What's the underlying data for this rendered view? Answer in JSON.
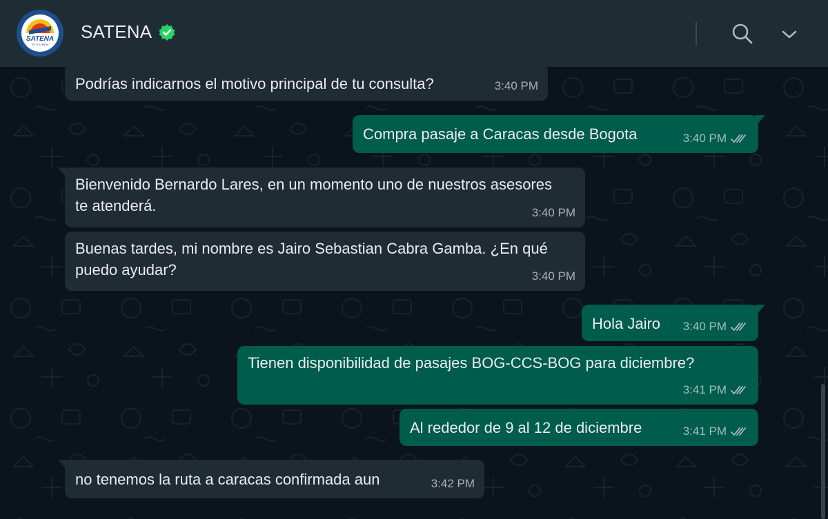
{
  "header": {
    "contact_name": "SATENA",
    "avatar_logo_text": "SATENA",
    "avatar_logo_subtext": "ES COLOMBIA",
    "verified_icon": "verified-badge-icon",
    "search_icon": "search-icon",
    "menu_icon": "chevron-down-icon"
  },
  "colors": {
    "header_bg": "#202c33",
    "chat_bg": "#0b141a",
    "incoming_bubble": "#202c33",
    "outgoing_bubble": "#005c4b",
    "verified_green": "#25d366",
    "text": "#e9edef"
  },
  "messages": [
    {
      "direction": "incoming",
      "text": "Podrías indicarnos el motivo principal de tu consulta?",
      "time": "3:40 PM"
    },
    {
      "direction": "outgoing",
      "text": "Compra pasaje a Caracas desde Bogota",
      "time": "3:40 PM",
      "status": "read"
    },
    {
      "direction": "incoming",
      "text": "Bienvenido Bernardo Lares, en un momento uno de nuestros asesores te atenderá.",
      "time": "3:40 PM"
    },
    {
      "direction": "incoming",
      "text": "Buenas tardes, mi nombre es Jairo Sebastian Cabra Gamba. ¿En qué puedo ayudar?",
      "time": "3:40 PM"
    },
    {
      "direction": "outgoing",
      "text": "Hola Jairo",
      "time": "3:40 PM",
      "status": "read"
    },
    {
      "direction": "outgoing",
      "text": "Tienen disponibilidad de pasajes BOG-CCS-BOG para diciembre?",
      "time": "3:41 PM",
      "status": "read"
    },
    {
      "direction": "outgoing",
      "text": "Al rededor de 9 al 12 de diciembre",
      "time": "3:41 PM",
      "status": "read"
    },
    {
      "direction": "incoming",
      "text": "no tenemos la ruta a caracas confirmada aun",
      "time": "3:42 PM"
    }
  ]
}
